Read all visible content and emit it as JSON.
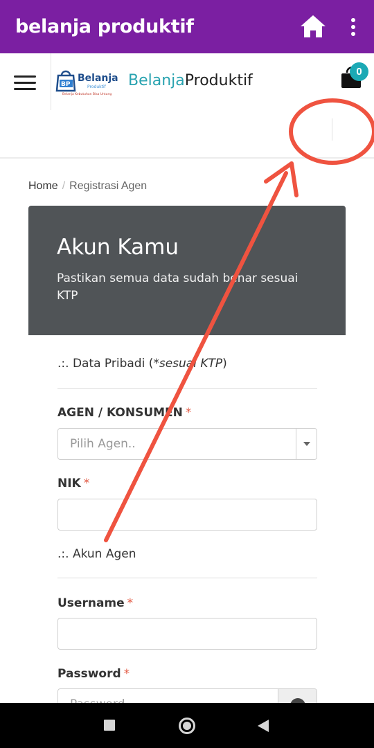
{
  "appbar": {
    "title": "belanja produktif",
    "color": "#7b1fa2",
    "home_icon": "home-icon",
    "menu_icon": "more-vert-icon"
  },
  "header": {
    "menu_icon": "hamburger-icon",
    "logo_text": "Belanja",
    "brand_accent": "Belanja",
    "brand_rest": "Produktif",
    "cart_icon": "shopping-bag-icon",
    "cart_count": "0"
  },
  "breadcrumb": {
    "home": "Home",
    "separator": "/",
    "current": "Registrasi Agen"
  },
  "card": {
    "title": "Akun Kamu",
    "subtitle": "Pastikan semua data sudah benar sesuai KTP"
  },
  "form": {
    "section1_prefix": ".:. Data Pribadi (",
    "section1_italic": "*sesuai KTP",
    "section1_suffix": ")",
    "agen_label": "AGEN / KONSUMEN",
    "agen_placeholder": "Pilih Agen..",
    "nik_label": "NIK",
    "section2": ".:. Akun Agen",
    "username_label": "Username",
    "password_label": "Password",
    "password_placeholder": "Password",
    "required_mark": "*"
  },
  "colors": {
    "accent": "#1ba9b5",
    "card_bg": "#505457",
    "required": "#e25841",
    "annotation": "#ef5340"
  }
}
